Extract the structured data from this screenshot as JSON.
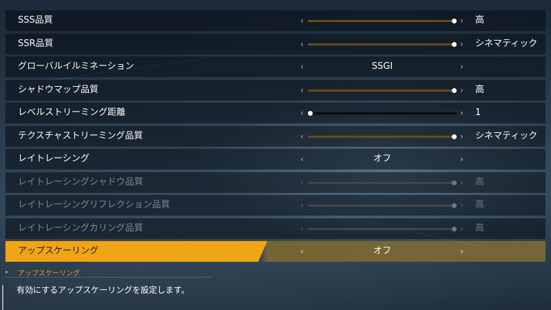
{
  "settings": [
    {
      "label": "SSS品質",
      "type": "slider",
      "value": "高",
      "level": 1.0,
      "disabled": false,
      "selected": false
    },
    {
      "label": "SSR品質",
      "type": "slider",
      "value": "シネマティック",
      "level": 1.0,
      "disabled": false,
      "selected": false
    },
    {
      "label": "グローバルイルミネーション",
      "type": "choice",
      "value": "SSGI",
      "disabled": false,
      "selected": false
    },
    {
      "label": "シャドウマップ品質",
      "type": "slider",
      "value": "高",
      "level": 1.0,
      "disabled": false,
      "selected": false
    },
    {
      "label": "レベルストリーミング距離",
      "type": "slider",
      "value": "1",
      "level": 0.0,
      "disabled": false,
      "selected": false
    },
    {
      "label": "テクスチャストリーミング品質",
      "type": "slider",
      "value": "シネマティック",
      "level": 1.0,
      "disabled": false,
      "selected": false
    },
    {
      "label": "レイトレーシング",
      "type": "choice",
      "value": "オフ",
      "disabled": false,
      "selected": false
    },
    {
      "label": "レイトレーシングシャドウ品質",
      "type": "slider",
      "value": "高",
      "level": 1.0,
      "disabled": true,
      "selected": false
    },
    {
      "label": "レイトレーシングリフレクション品質",
      "type": "slider",
      "value": "高",
      "level": 1.0,
      "disabled": true,
      "selected": false
    },
    {
      "label": "レイトレーシングカリング品質",
      "type": "slider",
      "value": "高",
      "level": 1.0,
      "disabled": true,
      "selected": false
    },
    {
      "label": "アップスケーリング",
      "type": "choice",
      "value": "オフ",
      "disabled": false,
      "selected": true
    }
  ],
  "arrows": {
    "left": "‹",
    "right": "›"
  },
  "description": {
    "title": "アップスケーリング",
    "text": "有効にするアップスケーリングを設定します。"
  },
  "colors": {
    "accent": "#f1a514",
    "slider_fill": "#6b4a16",
    "row_bg": "#0c141c"
  }
}
